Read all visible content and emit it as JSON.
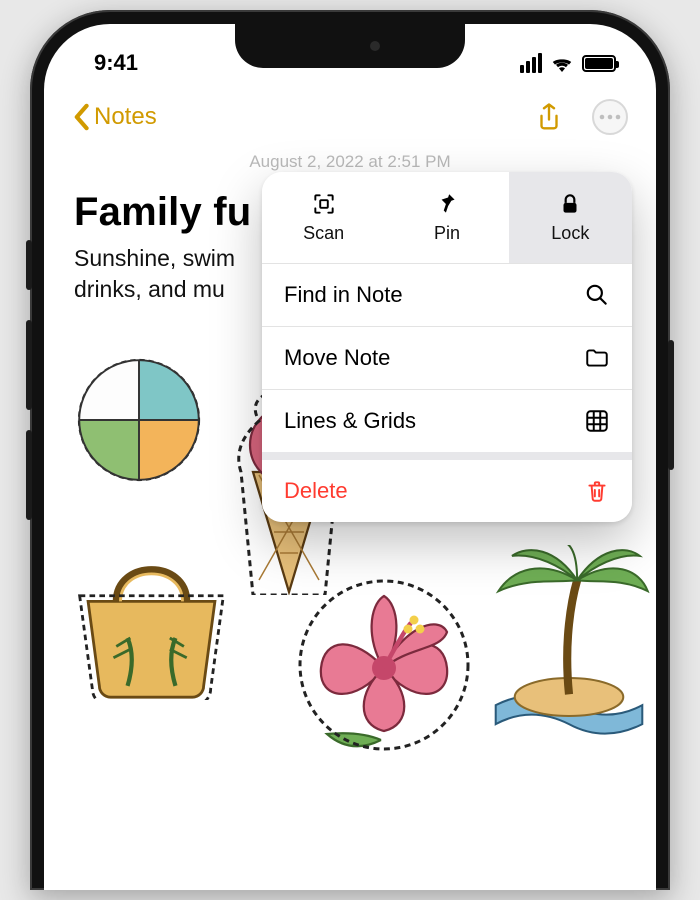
{
  "status": {
    "time": "9:41"
  },
  "nav": {
    "back_label": "Notes"
  },
  "note": {
    "date": "August 2, 2022 at 2:51 PM",
    "title": "Family fu",
    "body_line1": "Sunshine, swim",
    "body_line2": "drinks, and mu"
  },
  "menu": {
    "top": {
      "scan": "Scan",
      "pin": "Pin",
      "lock": "Lock"
    },
    "rows": {
      "find": "Find in Note",
      "move": "Move Note",
      "lines": "Lines & Grids",
      "delete": "Delete"
    }
  },
  "colors": {
    "accent": "#d19a00",
    "destructive": "#ff3b30"
  }
}
